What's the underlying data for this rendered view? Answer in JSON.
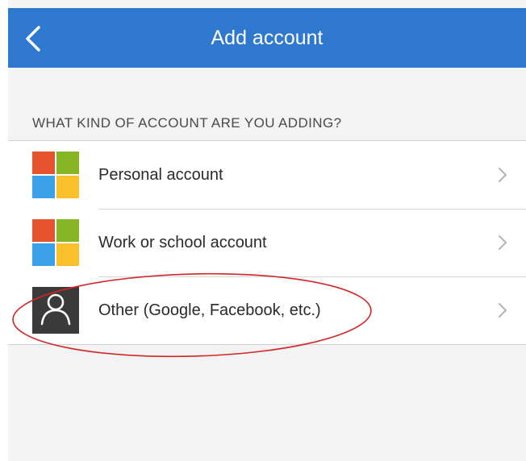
{
  "header": {
    "title": "Add account",
    "back_icon": "chevron-left-icon"
  },
  "section": {
    "label": "WHAT KIND OF ACCOUNT ARE YOU ADDING?"
  },
  "accounts": [
    {
      "label": "Personal account",
      "icon": "microsoft-logo-icon"
    },
    {
      "label": "Work or school account",
      "icon": "microsoft-logo-icon"
    },
    {
      "label": "Other (Google, Facebook, etc.)",
      "icon": "person-icon"
    }
  ],
  "colors": {
    "header_blue": "#2f78d0",
    "ms_red": "#e5532d",
    "ms_green": "#86b625",
    "ms_blue": "#3ba1e8",
    "ms_yellow": "#fbbf2c",
    "highlight_ellipse": "#d42525"
  }
}
